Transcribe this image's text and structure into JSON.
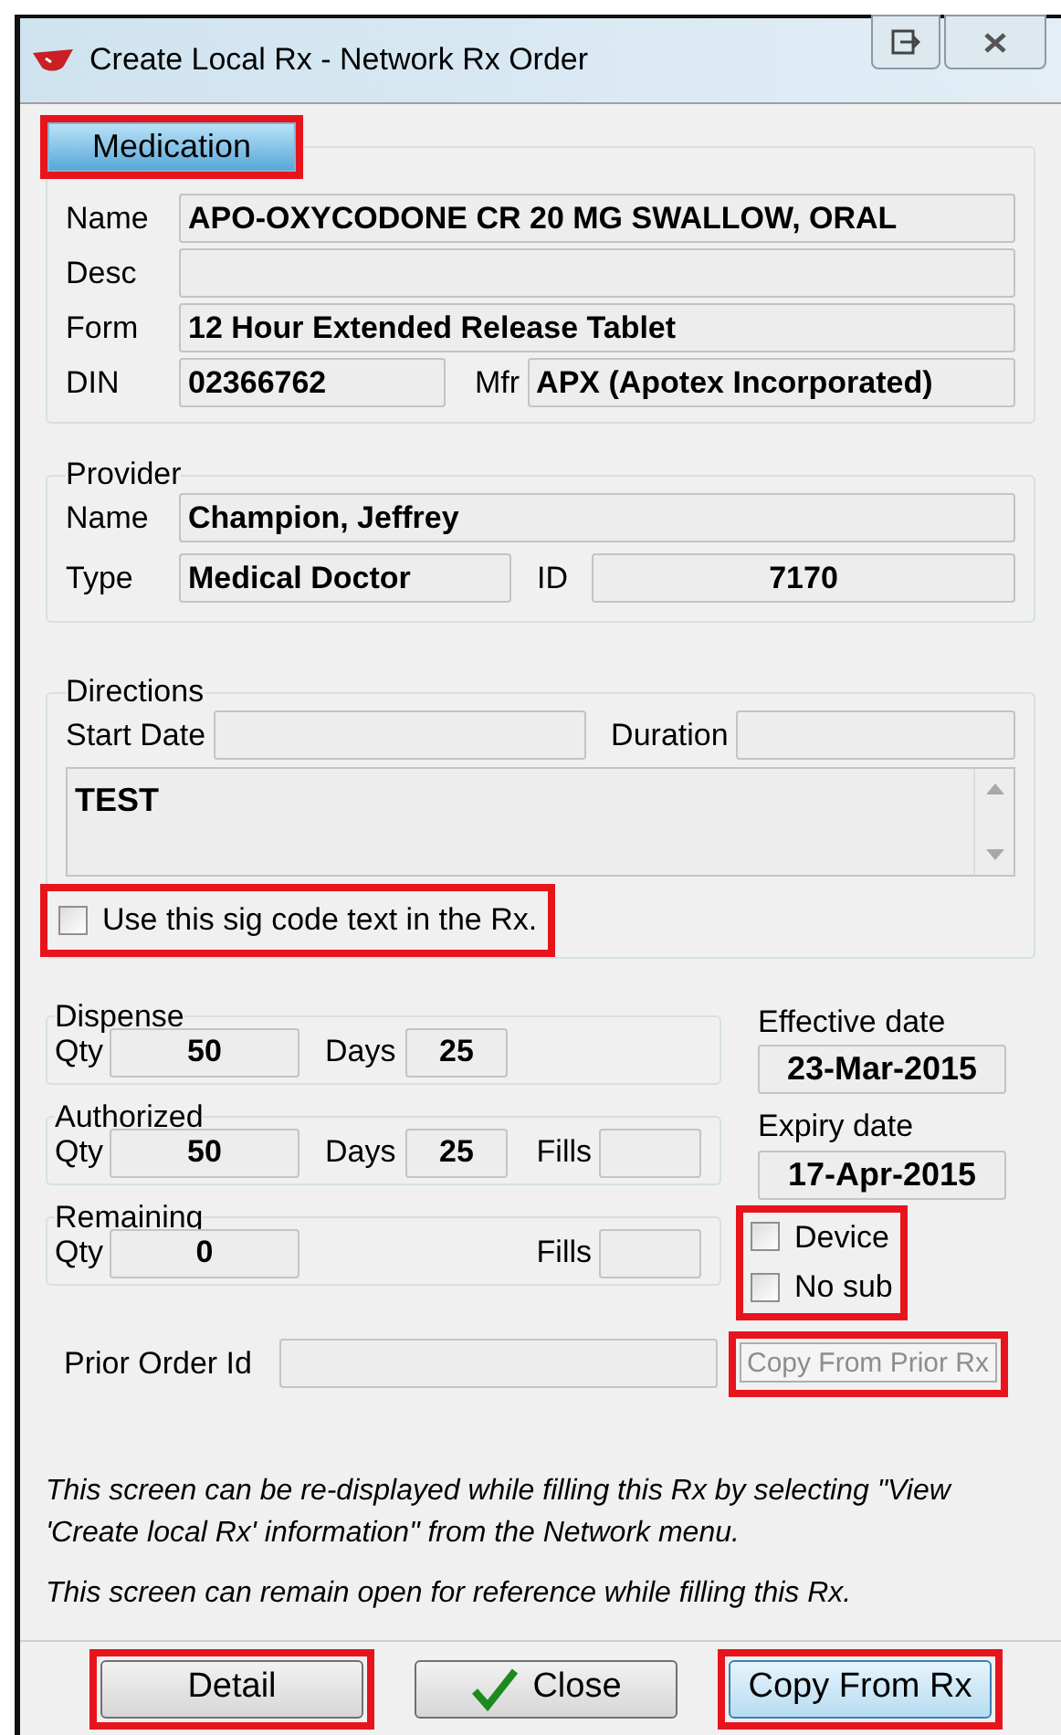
{
  "window": {
    "title": "Create Local Rx - Network Rx Order"
  },
  "medication": {
    "header": {
      "label": "Medication",
      "highlighted": true
    },
    "name": {
      "label": "Name",
      "value": "APO-OXYCODONE CR 20 MG SWALLOW, ORAL"
    },
    "desc": {
      "label": "Desc"
    },
    "form": {
      "label": "Form",
      "value": "12 Hour Extended Release Tablet"
    },
    "din": {
      "label": "DIN",
      "value": "02366762"
    },
    "mfr": {
      "label": "Mfr",
      "value": "APX (Apotex Incorporated)"
    }
  },
  "provider": {
    "title": "Provider",
    "name": {
      "label": "Name",
      "value": "Champion, Jeffrey"
    },
    "type": {
      "label": "Type",
      "value": "Medical Doctor"
    },
    "id": {
      "label": "ID",
      "value": "7170"
    }
  },
  "directions": {
    "title": "Directions",
    "start_date": {
      "label": "Start Date"
    },
    "duration": {
      "label": "Duration"
    },
    "text": "TEST",
    "use_sig": {
      "label": "Use this sig code text in the Rx.",
      "checked": false,
      "highlighted": true
    }
  },
  "quantities": [
    {
      "title": "Dispense",
      "qty": {
        "label": "Qty",
        "value": "50"
      },
      "days": {
        "label": "Days",
        "value": "25"
      }
    },
    {
      "title": "Authorized",
      "qty": {
        "label": "Qty",
        "value": "50"
      },
      "days": {
        "label": "Days",
        "value": "25"
      },
      "fills": {
        "label": "Fills"
      }
    },
    {
      "title": "Remaining",
      "qty": {
        "label": "Qty",
        "value": "0"
      },
      "fills": {
        "label": "Fills"
      }
    }
  ],
  "dates": [
    {
      "label": "Effective date",
      "value": "23-Mar-2015"
    },
    {
      "label": "Expiry date",
      "value": "17-Apr-2015"
    }
  ],
  "options": {
    "highlighted": true,
    "items": [
      {
        "label": "Device",
        "checked": false
      },
      {
        "label": "No sub",
        "checked": false
      }
    ]
  },
  "prior_order": {
    "label": "Prior Order Id"
  },
  "copy_prior": {
    "label": "Copy From Prior Rx",
    "disabled": true,
    "highlighted": true
  },
  "notes": [
    "This screen can be re-displayed while filling this Rx by selecting \"View 'Create local Rx' information\" from the Network menu.",
    "This screen can remain open for reference while filling this Rx."
  ],
  "buttons": [
    {
      "kind": "plain",
      "label": "Detail",
      "highlighted": true,
      "focused": false
    },
    {
      "kind": "check",
      "label": "Close",
      "highlighted": false,
      "focused": false
    },
    {
      "kind": "plain",
      "label": "Copy From Rx",
      "highlighted": true,
      "focused": true
    }
  ]
}
